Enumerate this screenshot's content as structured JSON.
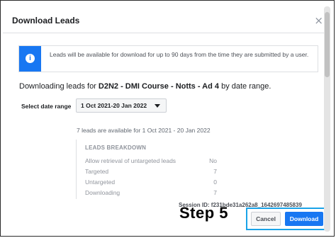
{
  "dialog": {
    "title": "Download Leads",
    "close_glyph": "×"
  },
  "info": {
    "icon": "info-icon",
    "icon_glyph": "i",
    "text": "Leads will be available for download for up to 90 days from the time they are submitted by a user."
  },
  "downloading": {
    "prefix": "Downloading leads for ",
    "ad_name": "D2N2 - DMI Course - Notts - Ad 4",
    "suffix": " by date range."
  },
  "date_range": {
    "label": "Select date range",
    "selected": "1 Oct 2021-20 Jan 2022"
  },
  "availability": "7 leads are available for 1 Oct 2021 - 20 Jan 2022",
  "breakdown": {
    "title": "LEADS BREAKDOWN",
    "rows": [
      {
        "label": "Allow retrieval of untargeted leads",
        "value": "No"
      },
      {
        "label": "Targeted",
        "value": "7"
      },
      {
        "label": "Untargeted",
        "value": "0"
      },
      {
        "label": "Downloading",
        "value": "7"
      }
    ]
  },
  "session": "Session ID: f231bde31a262a8_1642697485839",
  "annotation": {
    "step": "Step 5",
    "highlight_color": "#1aa3e8"
  },
  "buttons": {
    "cancel": "Cancel",
    "download": "Download"
  },
  "colors": {
    "primary": "#1877f2"
  }
}
